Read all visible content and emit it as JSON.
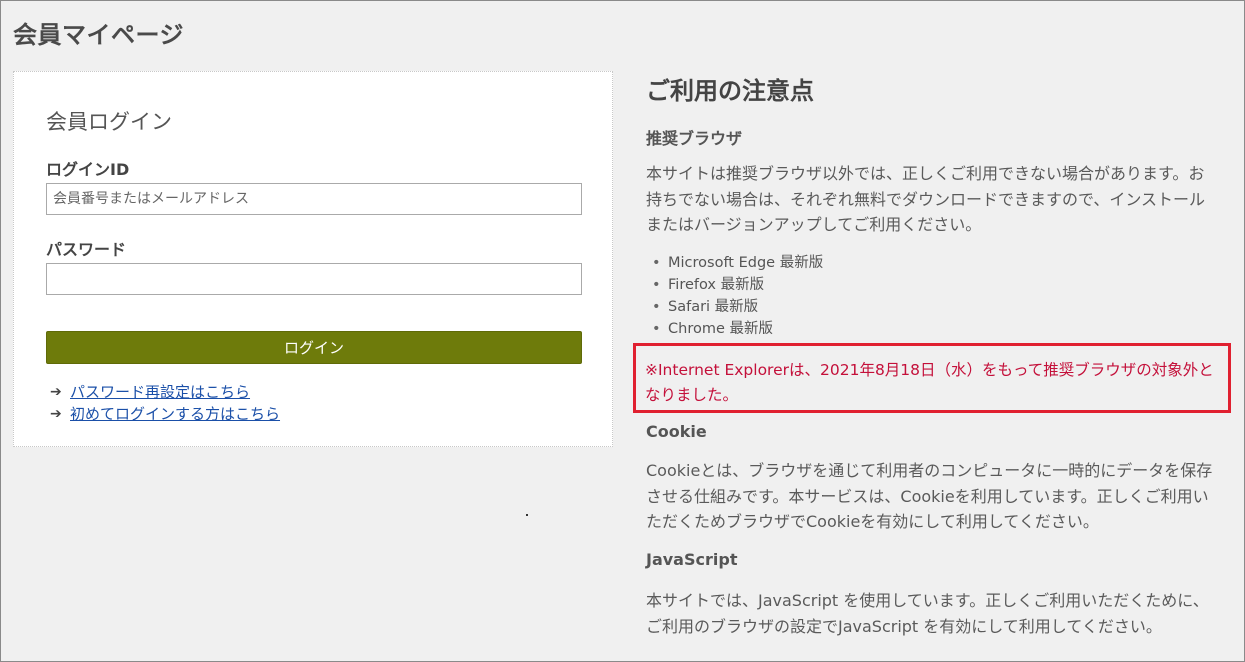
{
  "page": {
    "title": "会員マイページ"
  },
  "login": {
    "heading": "会員ログイン",
    "id_label": "ログインID",
    "id_placeholder": "会員番号またはメールアドレス",
    "id_value": "",
    "password_label": "パスワード",
    "password_value": "",
    "button_label": "ログイン",
    "links": [
      {
        "arrow": "➔",
        "label": "パスワード再設定はこちら"
      },
      {
        "arrow": "➔",
        "label": "初めてログインする方はこちら"
      }
    ]
  },
  "notes": {
    "heading": "ご利用の注意点",
    "browser": {
      "heading": "推奨ブラウザ",
      "text": "本サイトは推奨ブラウザ以外では、正しくご利用できない場合があります。お持ちでない場合は、それぞれ無料でダウンロードできますので、インストールまたはバージョンアップしてご利用ください。",
      "items": [
        "Microsoft Edge 最新版",
        "Firefox 最新版",
        "Safari 最新版",
        "Chrome 最新版"
      ],
      "ie_notice": "※Internet Explorerは、2021年8月18日（水）をもって推奨ブラウザの対象外となりました。"
    },
    "cookie": {
      "heading": "Cookie",
      "text": "Cookieとは、ブラウザを通じて利用者のコンピュータに一時的にデータを保存させる仕組みです。本サービスは、Cookieを利用しています。正しくご利用いただくためブラウザでCookieを有効にして利用してください。"
    },
    "javascript": {
      "heading": "JavaScript",
      "text": "本サイトでは、JavaScript を使用しています。正しくご利用いただくために、ご利用のブラウザの設定でJavaScript を有効にして利用してください。"
    }
  },
  "colors": {
    "login_button": "#6e7b0b",
    "link": "#1a4fa8",
    "notice_border": "#e02030",
    "notice_text": "#c4103a",
    "background": "#f0f0f0"
  }
}
